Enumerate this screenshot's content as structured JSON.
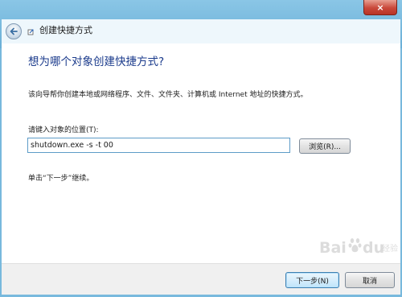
{
  "window": {
    "close_label": "×",
    "title": "创建快捷方式"
  },
  "main": {
    "heading": "想为哪个对象创建快捷方式?",
    "description": "该向导帮你创建本地或网络程序、文件、文件夹、计算机或 Internet 地址的快捷方式。",
    "location_label": "请键入对象的位置(T):",
    "location_value": "shutdown.exe -s -t 00",
    "browse_label": "浏览(R)...",
    "hint": "单击“下一步”继续。"
  },
  "footer": {
    "next_label": "下一步(N)",
    "cancel_label": "取消"
  },
  "watermark": {
    "text": "Baidu 经验"
  },
  "icons": {
    "back": "back-arrow-icon",
    "wizard": "shortcut-wizard-icon",
    "close": "close-icon"
  },
  "colors": {
    "frame": "#78b9dd",
    "heading": "#1b3b8c",
    "close_button": "#c9483a",
    "input_border": "#5d9cc8"
  }
}
